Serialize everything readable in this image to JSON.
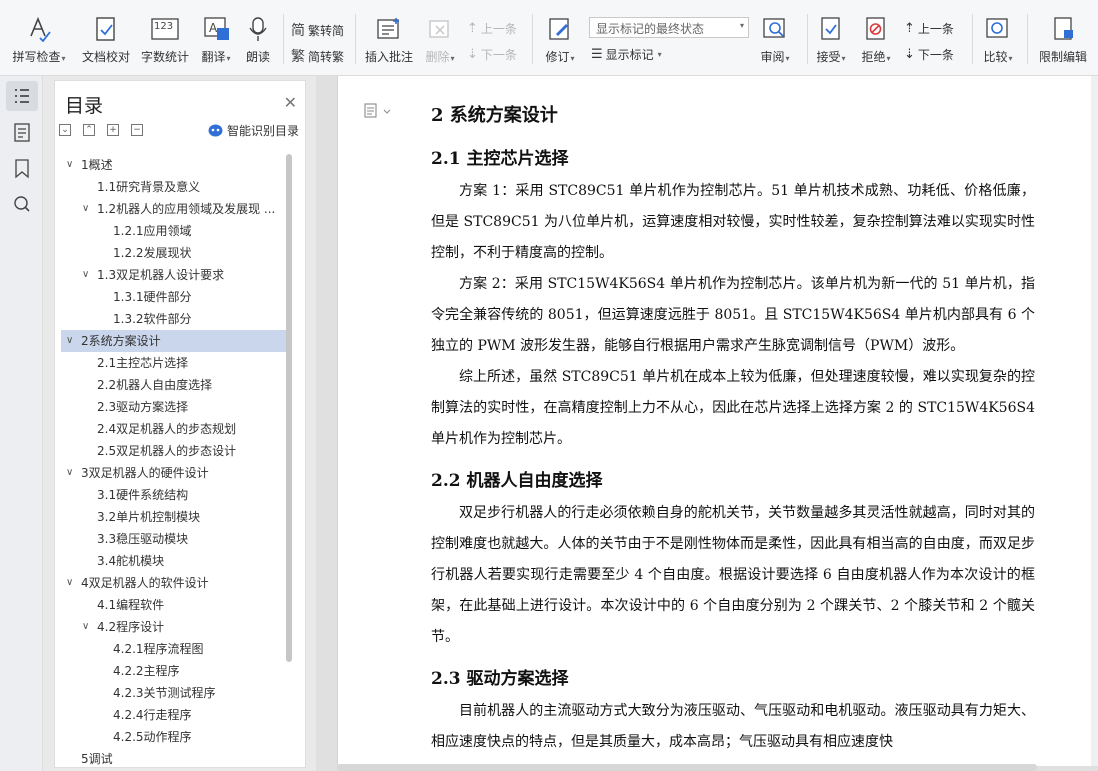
{
  "ribbon": {
    "spell_check": "拼写检查",
    "doc_check": "文档校对",
    "word_count": "字数统计",
    "translate": "翻译",
    "read_aloud": "朗读",
    "trad_to_simp": "繁转简",
    "simp_to_trad": "简转繁",
    "insert_comment": "插入批注",
    "delete": "删除",
    "prev_comment": "上一条",
    "next_comment": "下一条",
    "revise": "修订",
    "display_state": "显示标记的最终状态",
    "show_marks": "显示标记",
    "review": "审阅",
    "accept": "接受",
    "reject": "拒绝",
    "prev_change": "上一条",
    "next_change": "下一条",
    "compare": "比较",
    "restrict_edit": "限制编辑",
    "word_icon_text": "123",
    "accent": "#2f6fd6"
  },
  "toc": {
    "title": "目录",
    "smart_label": "智能识别目录",
    "items": [
      {
        "label": "1概述",
        "level": 1,
        "expanded": true,
        "selected": false
      },
      {
        "label": "1.1研究背景及意义",
        "level": 2,
        "expanded": null,
        "selected": false
      },
      {
        "label": "1.2机器人的应用领域及发展现 ...",
        "level": 2,
        "expanded": true,
        "selected": false
      },
      {
        "label": "1.2.1应用领域",
        "level": 3,
        "expanded": null,
        "selected": false
      },
      {
        "label": "1.2.2发展现状",
        "level": 3,
        "expanded": null,
        "selected": false
      },
      {
        "label": "1.3双足机器人设计要求",
        "level": 2,
        "expanded": true,
        "selected": false
      },
      {
        "label": "1.3.1硬件部分",
        "level": 3,
        "expanded": null,
        "selected": false
      },
      {
        "label": "1.3.2软件部分",
        "level": 3,
        "expanded": null,
        "selected": false
      },
      {
        "label": "2系统方案设计",
        "level": 1,
        "expanded": true,
        "selected": true
      },
      {
        "label": "2.1主控芯片选择",
        "level": 2,
        "expanded": null,
        "selected": false
      },
      {
        "label": "2.2机器人自由度选择",
        "level": 2,
        "expanded": null,
        "selected": false
      },
      {
        "label": "2.3驱动方案选择",
        "level": 2,
        "expanded": null,
        "selected": false
      },
      {
        "label": "2.4双足机器人的步态规划",
        "level": 2,
        "expanded": null,
        "selected": false
      },
      {
        "label": "2.5双足机器人的步态设计",
        "level": 2,
        "expanded": null,
        "selected": false
      },
      {
        "label": "3双足机器人的硬件设计",
        "level": 1,
        "expanded": true,
        "selected": false
      },
      {
        "label": "3.1硬件系统结构",
        "level": 2,
        "expanded": null,
        "selected": false
      },
      {
        "label": "3.2单片机控制模块",
        "level": 2,
        "expanded": null,
        "selected": false
      },
      {
        "label": "3.3稳压驱动模块",
        "level": 2,
        "expanded": null,
        "selected": false
      },
      {
        "label": "3.4舵机模块",
        "level": 2,
        "expanded": null,
        "selected": false
      },
      {
        "label": "4双足机器人的软件设计",
        "level": 1,
        "expanded": true,
        "selected": false
      },
      {
        "label": "4.1编程软件",
        "level": 2,
        "expanded": null,
        "selected": false
      },
      {
        "label": "4.2程序设计",
        "level": 2,
        "expanded": true,
        "selected": false
      },
      {
        "label": "4.2.1程序流程图",
        "level": 3,
        "expanded": null,
        "selected": false
      },
      {
        "label": "4.2.2主程序",
        "level": 3,
        "expanded": null,
        "selected": false
      },
      {
        "label": "4.2.3关节测试程序",
        "level": 3,
        "expanded": null,
        "selected": false
      },
      {
        "label": "4.2.4行走程序",
        "level": 3,
        "expanded": null,
        "selected": false
      },
      {
        "label": "4.2.5动作程序",
        "level": 3,
        "expanded": null,
        "selected": false
      },
      {
        "label": "5调试",
        "level": 1,
        "expanded": null,
        "selected": false
      }
    ]
  },
  "doc": {
    "h1": "2   系统方案设计",
    "h2_1": "2.1  主控芯片选择",
    "p1": "方案 1：采用 STC89C51 单片机作为控制芯片。51 单片机技术成熟、功耗低、价格低廉，但是 STC89C51 为八位单片机，运算速度相对较慢，实时性较差，复杂控制算法难以实现实时性控制，不利于精度高的控制。",
    "p2": "方案 2：采用 STC15W4K56S4 单片机作为控制芯片。该单片机为新一代的 51 单片机，指令完全兼容传统的 8051，但运算速度远胜于 8051。且 STC15W4K56S4 单片机内部具有 6 个独立的 PWM 波形发生器，能够自行根据用户需求产生脉宽调制信号（PWM）波形。",
    "p3": "综上所述，虽然 STC89C51 单片机在成本上较为低廉，但处理速度较慢，难以实现复杂的控制算法的实时性，在高精度控制上力不从心，因此在芯片选择上选择方案 2 的 STC15W4K56S4 单片机作为控制芯片。",
    "h2_2": "2.2  机器人自由度选择",
    "p4": "双足步行机器人的行走必须依赖自身的舵机关节，关节数量越多其灵活性就越高，同时对其的控制难度也就越大。人体的关节由于不是刚性物体而是柔性，因此具有相当高的自由度，而双足步行机器人若要实现行走需要至少 4 个自由度。根据设计要选择 6 自由度机器人作为本次设计的框架，在此基础上进行设计。本次设计中的 6 个自由度分别为 2 个踝关节、2 个膝关节和 2 个髋关节。",
    "h2_3": "2.3  驱动方案选择",
    "p5": "目前机器人的主流驱动方式大致分为液压驱动、气压驱动和电机驱动。液压驱动具有力矩大、相应速度快点的特点，但是其质量大，成本高昂；气压驱动具有相应速度快"
  }
}
